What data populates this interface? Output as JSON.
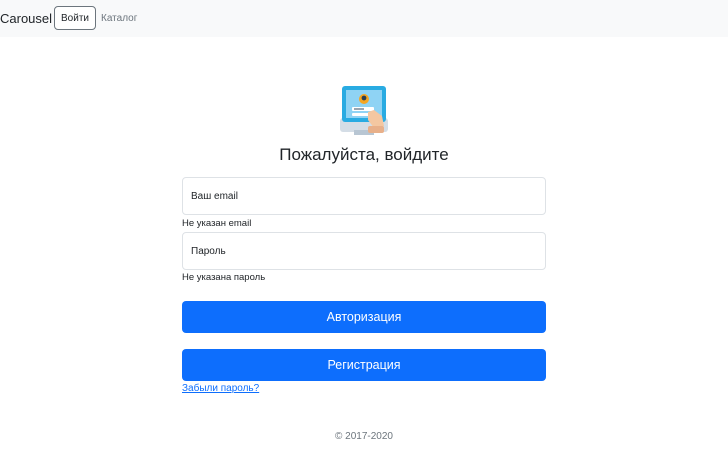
{
  "navbar": {
    "brand": "Carousel",
    "login_label": "Войти",
    "catalog_label": "Каталог"
  },
  "form": {
    "heading": "Пожалуйста, войдите",
    "email_placeholder": "Ваш email",
    "email_error": "Не указан email",
    "password_placeholder": "Пароль",
    "password_error": "Не указана пароль",
    "login_button": "Авторизация",
    "register_button": "Регистрация",
    "forgot_link": "Забыли пароль?"
  },
  "footer": {
    "copyright": "© 2017-2020"
  },
  "colors": {
    "primary": "#0d6efd",
    "navbar_bg": "#f8f9fa",
    "muted": "#6c757d"
  },
  "icons": {
    "logo": "computer-login-icon"
  }
}
